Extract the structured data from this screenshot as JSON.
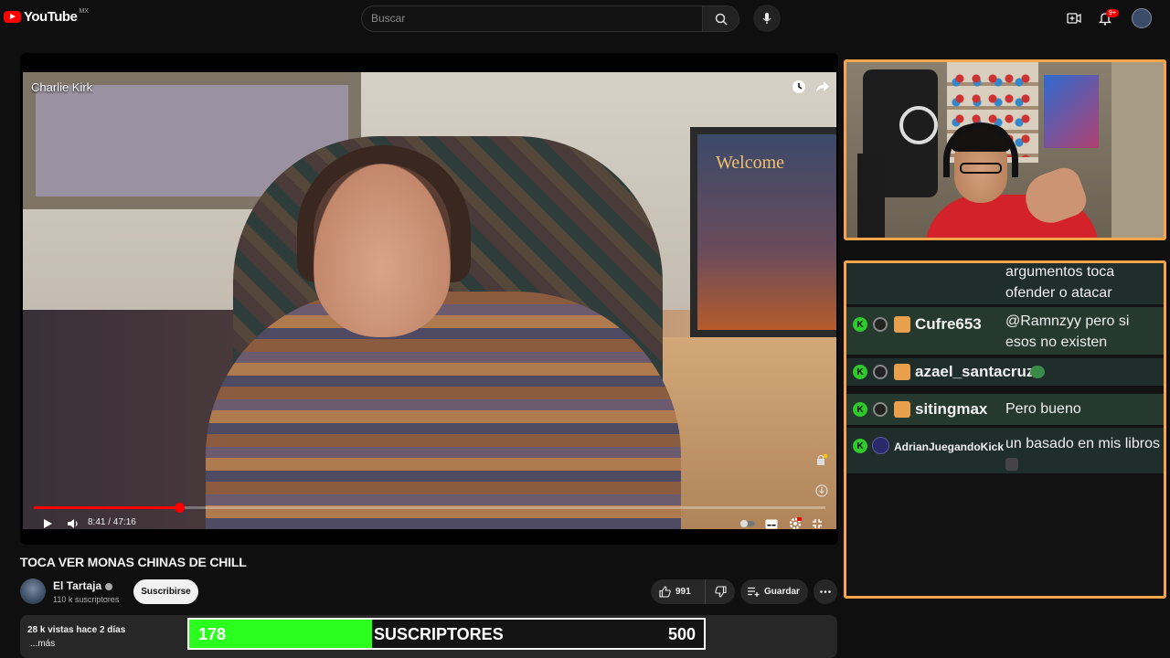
{
  "topbar": {
    "logo_text": "YouTube",
    "region": "MX",
    "search_placeholder": "Buscar",
    "notif_count": "9+"
  },
  "video": {
    "overlay_title": "Charlie Kirk",
    "poster_text": "Welcome",
    "time_current": "8:41",
    "time_total": "47:16",
    "time_display": "8:41 / 47:16",
    "progress_fraction": 0.1837
  },
  "details": {
    "title": "TOCA VER MONAS CHINAS DE CHILL",
    "channel_name": "El Tartaja",
    "subscribers": "110 k suscriptores",
    "subscribe_label": "Suscribirse",
    "likes": "991",
    "save_label": "Guardar",
    "stats": "28 k vistas  hace 2 días",
    "more": "...más"
  },
  "subgoal": {
    "current": "178",
    "label": "SUSCRIPTORES",
    "target": "500",
    "fill_fraction": 0.356
  },
  "chat": {
    "messages": [
      {
        "user": "",
        "text": "argumentos toca ofender o atacar"
      },
      {
        "user": "Cufre653",
        "text": "@Ramnzyy pero si esos no existen"
      },
      {
        "user": "azael_santacruz",
        "text": ""
      },
      {
        "user": "sitingmax",
        "text": "Pero bueno"
      },
      {
        "user": "AdrianJuegandoKick",
        "text": "un basado en mis libros"
      }
    ]
  },
  "colors": {
    "accent": "#ff0000",
    "panel_border": "#f7a44a",
    "goal_fill": "#2bff1d",
    "kick_badge": "#2ec92a"
  }
}
